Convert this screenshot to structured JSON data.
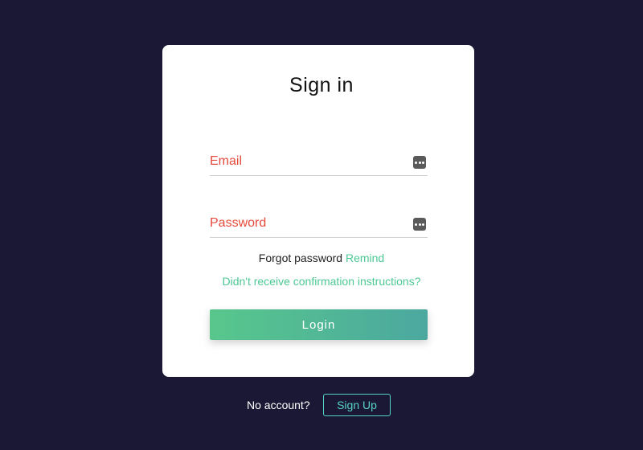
{
  "page": {
    "title": "Sign in"
  },
  "form": {
    "email": {
      "placeholder": "Email",
      "value": "",
      "icon": "password-manager-icon"
    },
    "password": {
      "placeholder": "Password",
      "value": "",
      "icon": "password-manager-icon"
    },
    "forgot_text": "Forgot password",
    "remind_link": "Remind",
    "confirmation_link": "Didn't receive confirmation instructions?",
    "login_label": "Login"
  },
  "footer": {
    "no_account_text": "No account?",
    "signup_label": "Sign Up"
  },
  "colors": {
    "background": "#1b1836",
    "card": "#ffffff",
    "placeholder": "#e64a3c",
    "link": "#4dc895",
    "button_gradient_start": "#58c78c",
    "button_gradient_end": "#4ba89f",
    "signup_border": "#57d3c2"
  }
}
